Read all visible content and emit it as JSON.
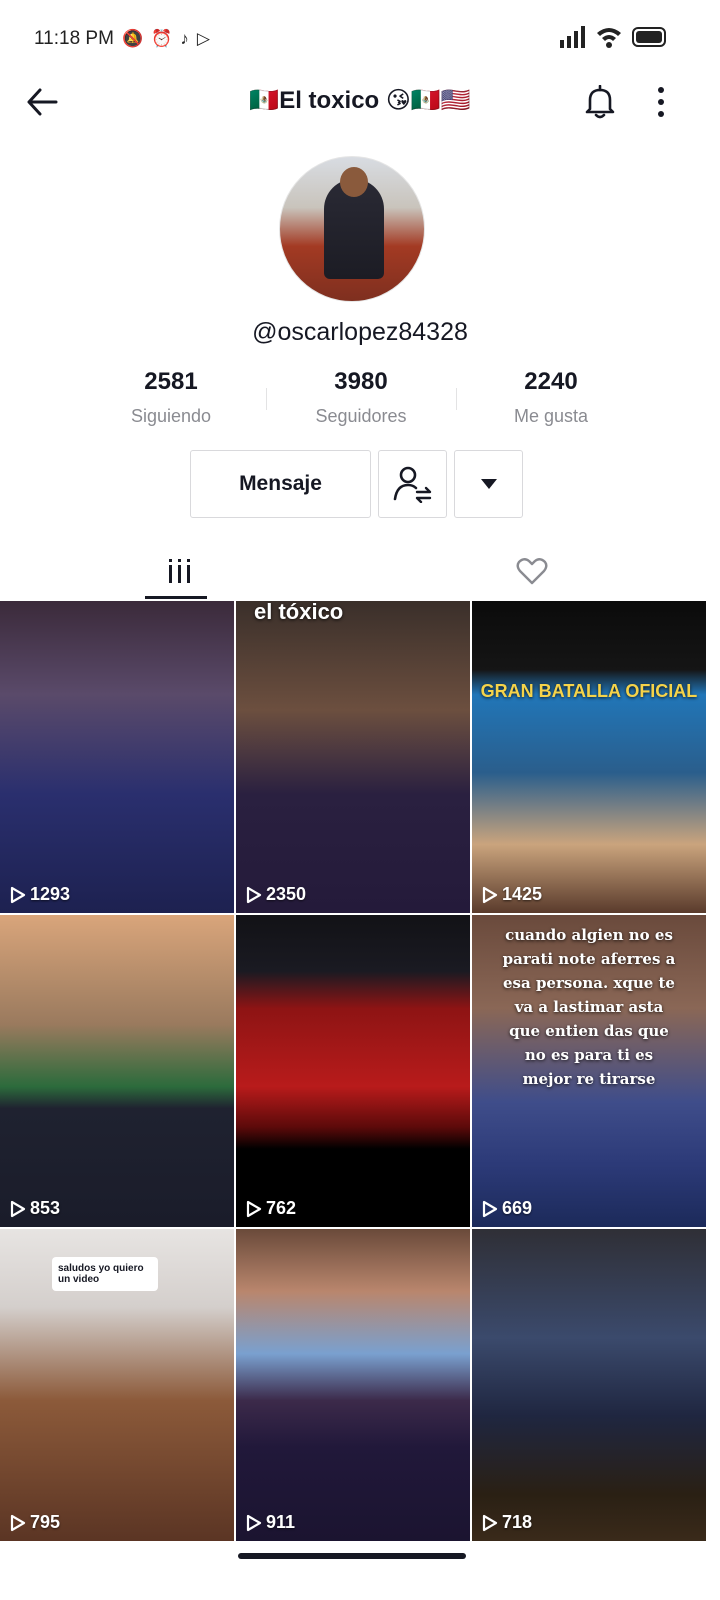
{
  "status_bar": {
    "time": "11:18 PM",
    "left_icons": [
      "mute-icon",
      "alarm-icon",
      "tiktok-icon",
      "play-store-icon"
    ],
    "right_icons": [
      "signal-icon",
      "wifi-icon",
      "battery-icon"
    ]
  },
  "header": {
    "title": "🇲🇽El toxico 😘🇲🇽🇺🇸",
    "back_icon": "arrow-left-icon",
    "bell_icon": "bell-icon",
    "more_icon": "more-vertical-icon"
  },
  "profile": {
    "username": "@oscarlopez84328"
  },
  "stats": [
    {
      "value": "2581",
      "label": "Siguiendo"
    },
    {
      "value": "3980",
      "label": "Seguidores"
    },
    {
      "value": "2240",
      "label": "Me gusta"
    }
  ],
  "actions": {
    "message_label": "Mensaje",
    "follow_icon": "person-swap-icon",
    "dropdown_icon": "caret-down-icon"
  },
  "tabs": [
    {
      "name": "videos",
      "icon": "grid-bars-icon",
      "active": true
    },
    {
      "name": "liked",
      "icon": "heart-outline-icon",
      "active": false
    }
  ],
  "videos": [
    {
      "views": "1293",
      "overlay": ""
    },
    {
      "views": "2350",
      "overlay": "el tóxico"
    },
    {
      "views": "1425",
      "overlay": "GRAN BATALLA OFICIAL"
    },
    {
      "views": "853",
      "overlay": ""
    },
    {
      "views": "762",
      "overlay": ""
    },
    {
      "views": "669",
      "overlay": "cuando algien no es parati note aferres a esa persona. xque te va a lastimar asta que entien das que no es para ti es mejor re tirarse"
    },
    {
      "views": "795",
      "overlay": "saludos yo quiero un video"
    },
    {
      "views": "911",
      "overlay": ""
    },
    {
      "views": "718",
      "overlay": ""
    }
  ],
  "colors": {
    "text_primary": "#161823",
    "text_secondary": "#8a8b91",
    "border": "#d9d9dc"
  }
}
